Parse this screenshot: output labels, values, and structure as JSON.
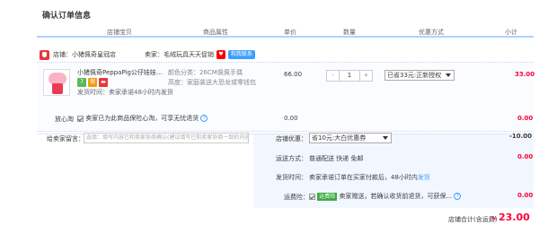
{
  "page_title": "确认订单信息",
  "columns": [
    "店铺宝贝",
    "商品属性",
    "单价",
    "数量",
    "优惠方式",
    "小计"
  ],
  "shop": {
    "label": "店铺：",
    "name": "小猪佩奇皇冠店",
    "seller_label": "卖家：",
    "seller_name": "毛绒玩具天天促销",
    "contact_label": "和我联系"
  },
  "item": {
    "name": "小猪佩奇PeppaPig公仔娃娃玩偶...",
    "icon_badges": [
      "7",
      "",
      ""
    ],
    "ship_note": "发货时间：卖家承诺48小时内发货",
    "attr_color": "颜色分类：26CM佩佩手偶",
    "attr_height": "高度：家庭装送大恐龙或零钱包",
    "price": "66.00",
    "qty_minus": "-",
    "qty": "1",
    "qty_plus": "+",
    "discount": "已省33元:正新授权",
    "subtotal": "33.00"
  },
  "peace": {
    "label": "放心淘",
    "text": "卖家已为此商品保险心淘，可享无忧退货",
    "help": "?",
    "price": "0.00",
    "subtotal": "0.00"
  },
  "message": {
    "label": "给卖家留言：",
    "placeholder": "选填：填写内容已和卖家协商确认(建议填写已和卖家协商一致的内容)"
  },
  "shop_coupon": {
    "label": "店铺优惠：",
    "value": "省10元:大白优惠券",
    "amount": "-10.00"
  },
  "shipping": {
    "label": "运送方式：",
    "value": "普通配送 快递 免邮",
    "amount": "0.00"
  },
  "delivery": {
    "label": "发货时间：",
    "value": "卖家承诺订单在买家付款后，48小时内",
    "link": "发货"
  },
  "insurance": {
    "label": "运费险：",
    "badge": "运费险",
    "text": "卖家赠送，若确认收货前退货，可获保...",
    "help": "?",
    "amount": "0.00"
  },
  "total": {
    "label": "店铺合计(含运费)",
    "currency": "¥",
    "value": "23.00"
  },
  "colors": {
    "accent_red": "#ff0036",
    "link_blue": "#3e9eff",
    "header_line": "#b2d1ff"
  }
}
